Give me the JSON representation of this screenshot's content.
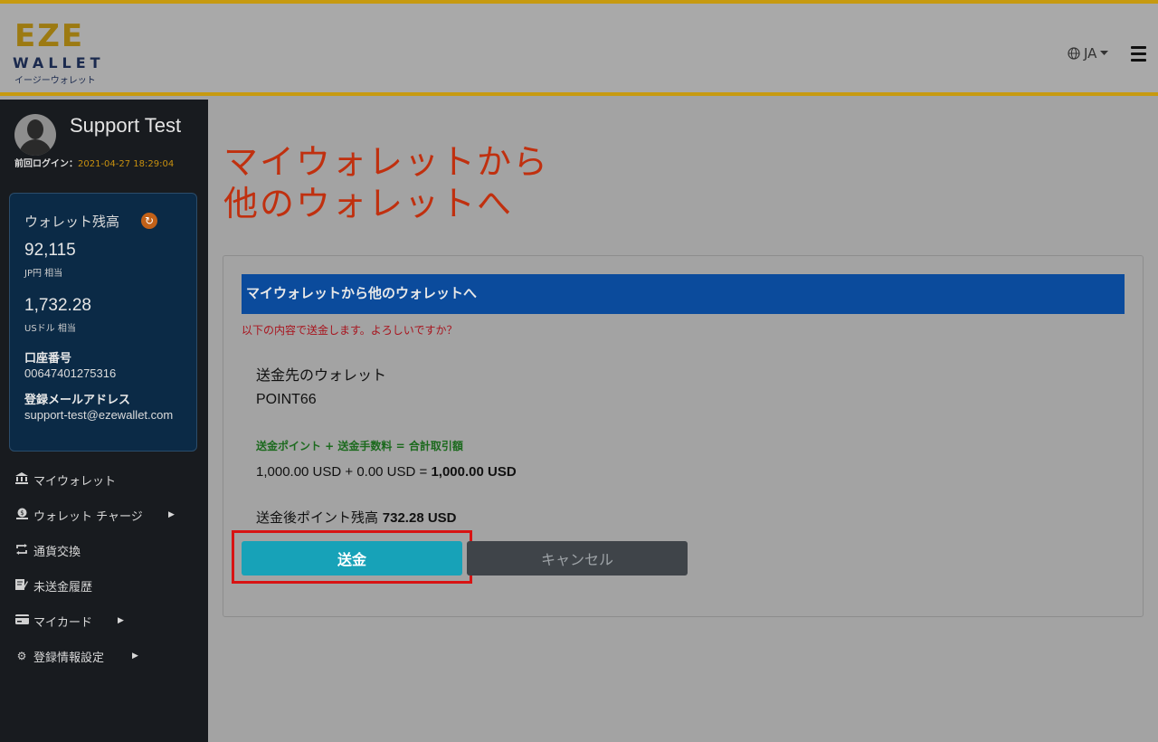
{
  "header": {
    "logo": {
      "wordmark": "EZE",
      "wallet_text": "WALLET",
      "kana_text": "イージーウォレット"
    },
    "language": "JA",
    "menu_icon": "hamburger-icon",
    "accent_color": "#c79a10"
  },
  "sidebar": {
    "user_name": "Support Test",
    "last_login_label": "前回ログイン：",
    "last_login_time": "2021-04-27 18:29:04",
    "wallet": {
      "title": "ウォレット残高",
      "jpy_amount": "92,115",
      "jpy_unit": "JP円 相当",
      "usd_amount": "1,732.28",
      "usd_unit": "USドル 相当",
      "account_label": "口座番号",
      "account_number": "00647401275316",
      "email_label": "登録メールアドレス",
      "email": "support-test@ezewallet.com"
    },
    "nav": [
      {
        "label": "マイウォレット",
        "icon": "bank-icon",
        "has_submenu": false
      },
      {
        "label": "ウォレット チャージ",
        "icon": "coin-upload-icon",
        "has_submenu": true
      },
      {
        "label": "通貨交換",
        "icon": "exchange-icon",
        "has_submenu": false
      },
      {
        "label": "未送金履歴",
        "icon": "history-edit-icon",
        "has_submenu": false
      },
      {
        "label": "マイカード",
        "icon": "credit-card-icon",
        "has_submenu": true
      },
      {
        "label": "登録情報設定",
        "icon": "gear-icon",
        "has_submenu": true
      }
    ]
  },
  "main": {
    "title_line1": "マイウォレットから",
    "title_line2": "他のウォレットへ",
    "panel": {
      "header": "マイウォレットから他のウォレットへ",
      "confirm_text": "以下の内容で送金します。よろしいですか？",
      "destination_label": "送金先のウォレット",
      "destination_value": "POINT66",
      "formula_label": "送金ポイント + 送金手数料 = 合計取引額",
      "formula_amount": "1,000.00 USD + 0.00 USD = ",
      "formula_total": "1,000.00 USD",
      "balance_after_label": "送金後ポイント残高 ",
      "balance_after_value": "732.28 USD",
      "send_button": "送金",
      "cancel_button": "キャンセル"
    }
  }
}
